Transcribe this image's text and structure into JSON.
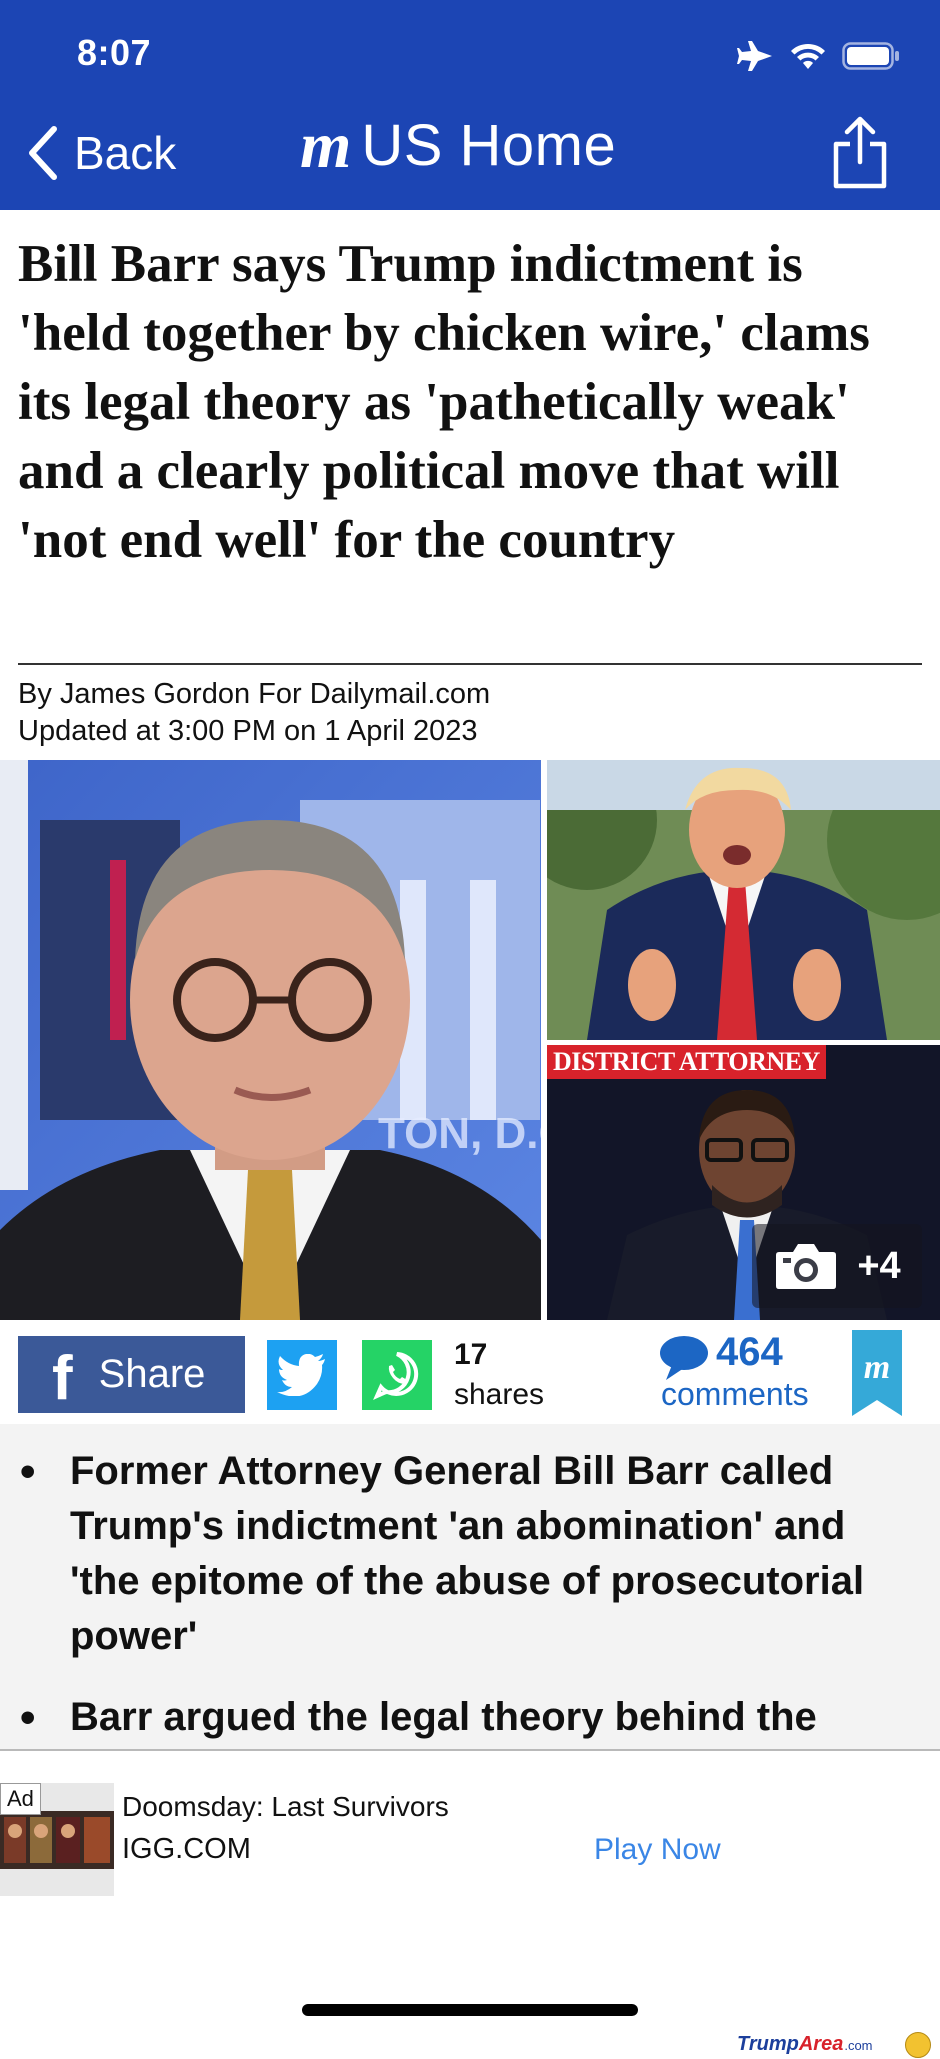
{
  "status_bar": {
    "time": "8:07"
  },
  "nav": {
    "back_label": "Back",
    "logo": "m",
    "title": "US Home"
  },
  "article": {
    "headline": "Bill Barr says Trump indictment is 'held together by chicken wire,' clams its legal theory as 'pathetically weak' and a clearly political move that will 'not end well' for the country",
    "byline": "By James Gordon For Dailymail.com",
    "updated": "Updated at 3:00 PM on 1 April 2023"
  },
  "photos": {
    "caption_overlay": "TON, D.C",
    "district_attorney_label": "DISTRICT ATTORNEY",
    "gallery_count": "+4"
  },
  "share_bar": {
    "facebook_label": "Share",
    "shares_count": "17",
    "shares_label": "shares",
    "comments_count": "464",
    "comments_label": "comments",
    "bookmark_logo": "m"
  },
  "bullets": [
    "Former Attorney General Bill Barr called Trump's indictment 'an abomination' and 'the epitome of the abuse of prosecutorial power'",
    "Barr argued the legal theory behind the"
  ],
  "ad": {
    "tag": "Ad",
    "title": "Doomsday: Last Survivors",
    "domain": "IGG.COM",
    "cta": "Play Now"
  },
  "watermark": {
    "brand_a": "Trump",
    "brand_b": "Area",
    "suffix": ".com"
  },
  "colors": {
    "header_blue": "#1c45b4",
    "facebook": "#3b5998",
    "twitter": "#1da1f2",
    "whatsapp": "#25d366",
    "comments_blue": "#1c66c4",
    "cta_blue": "#3a86e6",
    "da_red": "#d8222b"
  }
}
